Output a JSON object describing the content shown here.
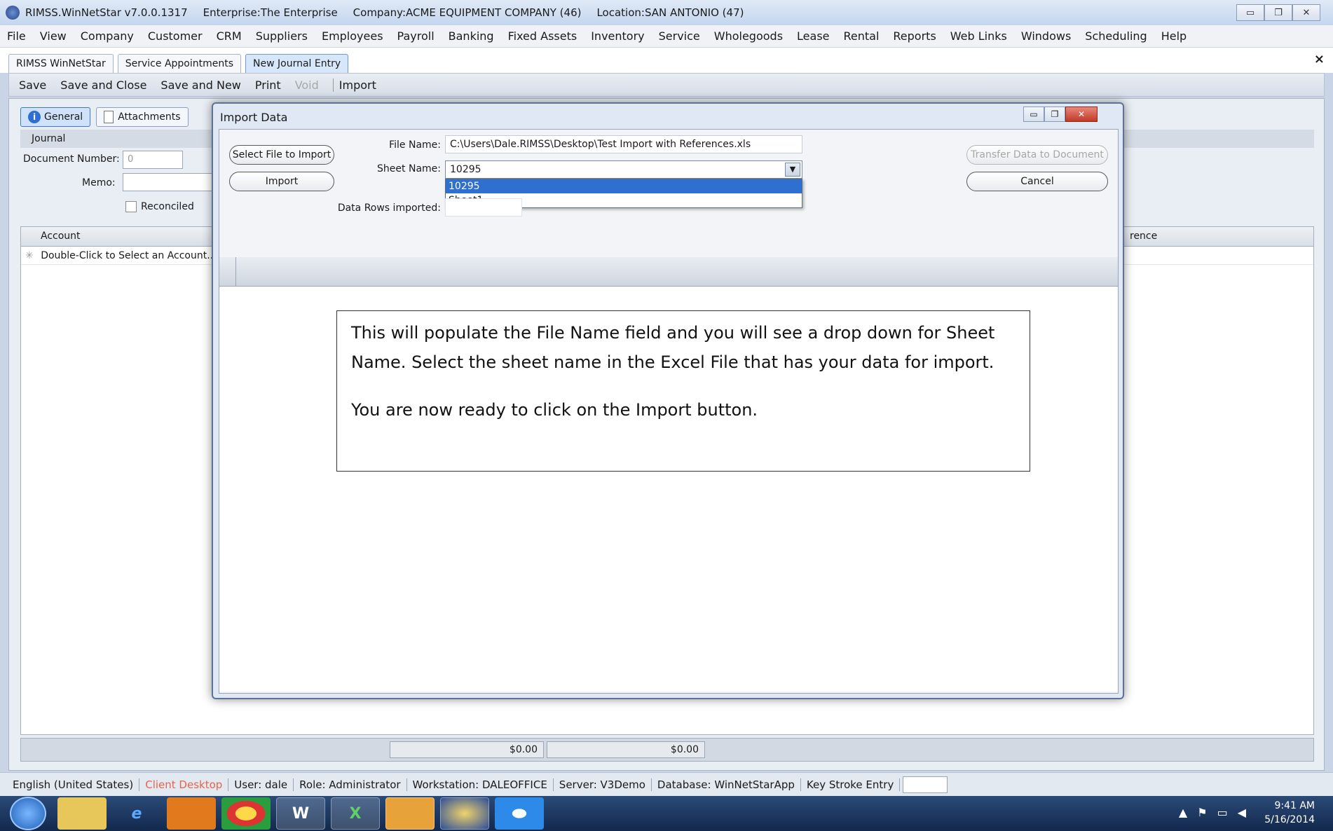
{
  "window": {
    "app_title": "RIMSS.WinNetStar v7.0.0.1317",
    "enterprise": "Enterprise:The Enterprise",
    "company": "Company:ACME EQUIPMENT COMPANY (46)",
    "location": "Location:SAN ANTONIO (47)"
  },
  "menu": [
    "File",
    "View",
    "Company",
    "Customer",
    "CRM",
    "Suppliers",
    "Employees",
    "Payroll",
    "Banking",
    "Fixed Assets",
    "Inventory",
    "Service",
    "Wholegoods",
    "Lease",
    "Rental",
    "Reports",
    "Web Links",
    "Windows",
    "Scheduling",
    "Help"
  ],
  "doc_tabs": [
    {
      "label": "RIMSS WinNetStar"
    },
    {
      "label": "Service Appointments"
    },
    {
      "label": "New Journal Entry"
    }
  ],
  "toolbar": {
    "save": "Save",
    "save_close": "Save and Close",
    "save_new": "Save and New",
    "print": "Print",
    "void": "Void",
    "import": "Import"
  },
  "form": {
    "tab_general": "General",
    "tab_attachments": "Attachments",
    "section": "Journal",
    "doc_number_label": "Document Number:",
    "doc_number_value": "0",
    "memo_label": "Memo:",
    "reconciled_label": "Reconciled",
    "col_account": "Account",
    "col_reference": "rence",
    "row_placeholder": "Double-Click to Select an Account...",
    "total1": "$0.00",
    "total2": "$0.00"
  },
  "dialog": {
    "title": "Import Data",
    "select_file": "Select File to Import",
    "import": "Import",
    "file_name_label": "File Name:",
    "file_name_value": "C:\\Users\\Dale.RIMSS\\Desktop\\Test Import with References.xls",
    "sheet_name_label": "Sheet Name:",
    "sheet_name_value": "10295",
    "sheet_options": [
      "10295",
      "Sheet1"
    ],
    "rows_imported_label": "Data Rows imported:",
    "transfer": "Transfer Data to Document",
    "cancel": "Cancel"
  },
  "callout": {
    "line1": "This will populate the File Name field and you will see a drop down for Sheet Name.  Select the sheet name in the Excel File that has your data for import.",
    "line2": "You are now ready to click on the Import button."
  },
  "status": {
    "language": "English (United States)",
    "mode": "Client Desktop",
    "user": "User: dale",
    "role": "Role: Administrator",
    "workstation": "Workstation: DALEOFFICE",
    "server": "Server: V3Demo",
    "database": "Database: WinNetStarApp",
    "keystroke": "Key Stroke Entry"
  },
  "clock": {
    "time": "9:41 AM",
    "date": "5/16/2014"
  },
  "colors": {
    "accent": "#2f6fd0",
    "mode_text": "#e8634a"
  }
}
